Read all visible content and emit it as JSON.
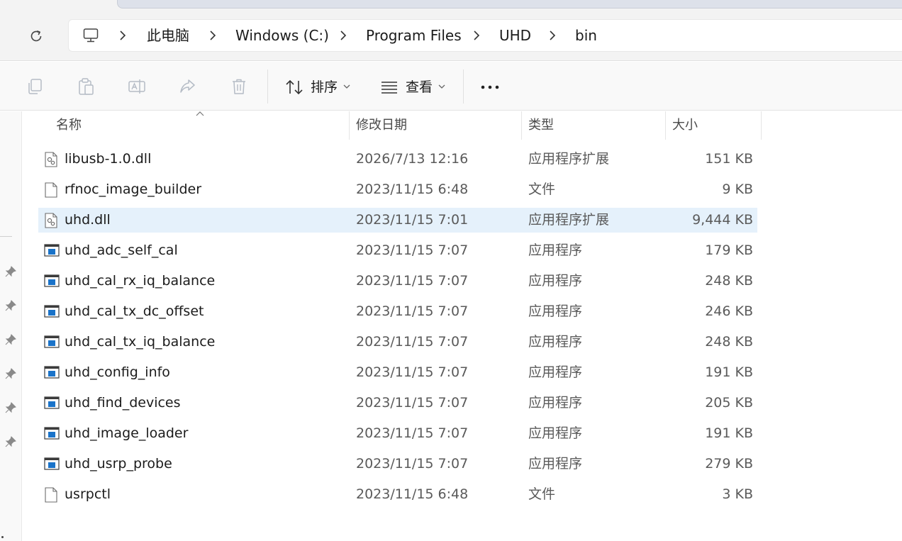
{
  "address_bar": {
    "breadcrumbs": [
      "此电脑",
      "Windows (C:)",
      "Program Files",
      "UHD",
      "bin"
    ]
  },
  "toolbar": {
    "sort_label": "排序",
    "view_label": "查看"
  },
  "columns": {
    "name": "名称",
    "date": "修改日期",
    "type": "类型",
    "size": "大小"
  },
  "files": [
    {
      "name": "libusb-1.0.dll",
      "date": "2026/7/13 12:16",
      "type": "应用程序扩展",
      "size": "151 KB",
      "icon": "dll-file-icon",
      "selected": false
    },
    {
      "name": "rfnoc_image_builder",
      "date": "2023/11/15 6:48",
      "type": "文件",
      "size": "9 KB",
      "icon": "generic-file-icon",
      "selected": false
    },
    {
      "name": "uhd.dll",
      "date": "2023/11/15 7:01",
      "type": "应用程序扩展",
      "size": "9,444 KB",
      "icon": "dll-file-icon",
      "selected": true
    },
    {
      "name": "uhd_adc_self_cal",
      "date": "2023/11/15 7:07",
      "type": "应用程序",
      "size": "179 KB",
      "icon": "exe-file-icon",
      "selected": false
    },
    {
      "name": "uhd_cal_rx_iq_balance",
      "date": "2023/11/15 7:07",
      "type": "应用程序",
      "size": "248 KB",
      "icon": "exe-file-icon",
      "selected": false
    },
    {
      "name": "uhd_cal_tx_dc_offset",
      "date": "2023/11/15 7:07",
      "type": "应用程序",
      "size": "246 KB",
      "icon": "exe-file-icon",
      "selected": false
    },
    {
      "name": "uhd_cal_tx_iq_balance",
      "date": "2023/11/15 7:07",
      "type": "应用程序",
      "size": "248 KB",
      "icon": "exe-file-icon",
      "selected": false
    },
    {
      "name": "uhd_config_info",
      "date": "2023/11/15 7:07",
      "type": "应用程序",
      "size": "191 KB",
      "icon": "exe-file-icon",
      "selected": false
    },
    {
      "name": "uhd_find_devices",
      "date": "2023/11/15 7:07",
      "type": "应用程序",
      "size": "205 KB",
      "icon": "exe-file-icon",
      "selected": false
    },
    {
      "name": "uhd_image_loader",
      "date": "2023/11/15 7:07",
      "type": "应用程序",
      "size": "191 KB",
      "icon": "exe-file-icon",
      "selected": false
    },
    {
      "name": "uhd_usrp_probe",
      "date": "2023/11/15 7:07",
      "type": "应用程序",
      "size": "279 KB",
      "icon": "exe-file-icon",
      "selected": false
    },
    {
      "name": "usrpctl",
      "date": "2023/11/15 6:48",
      "type": "文件",
      "size": "3 KB",
      "icon": "generic-file-icon",
      "selected": false
    }
  ],
  "colors": {
    "selection": "#e5f1fb",
    "exe_icon_blue": "#1a73c9"
  }
}
